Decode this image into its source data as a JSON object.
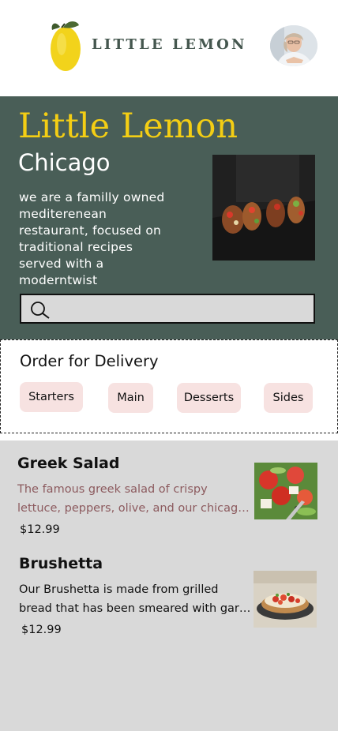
{
  "header": {
    "logo_text": "LITTLE LEMON",
    "logo_icon": "lemon-icon",
    "avatar_icon": "user-avatar"
  },
  "hero": {
    "title": "Little Lemon",
    "city": "Chicago",
    "description": "we are a familly owned mediterenean restaurant, focused on traditional recipes served with a moderntwist",
    "search": {
      "value": "",
      "placeholder": "",
      "icon": "search-icon"
    }
  },
  "delivery": {
    "title": "Order for Delivery",
    "categories": [
      "Starters",
      "Main",
      "Desserts",
      "Sides"
    ]
  },
  "menu": {
    "items": [
      {
        "name": "Greek Salad",
        "description": "The famous greek salad of crispy lettuce, peppers, olive, and our chicago style feta cheese, garnished with crunchy garlic and rosemary croutons.",
        "price": "$12.99"
      },
      {
        "name": "Brushetta",
        "description": "Our Brushetta is made from grilled bread that has been smeared with garlic and seasoned with salt and olive oil.",
        "price": "$12.99"
      }
    ]
  },
  "colors": {
    "primary_green": "#495e57",
    "primary_yellow": "#f4ce14",
    "chip_pink": "#f7e2e1",
    "menu_bg": "#d9d9d9",
    "greek_desc_color": "#8c5a5e"
  }
}
